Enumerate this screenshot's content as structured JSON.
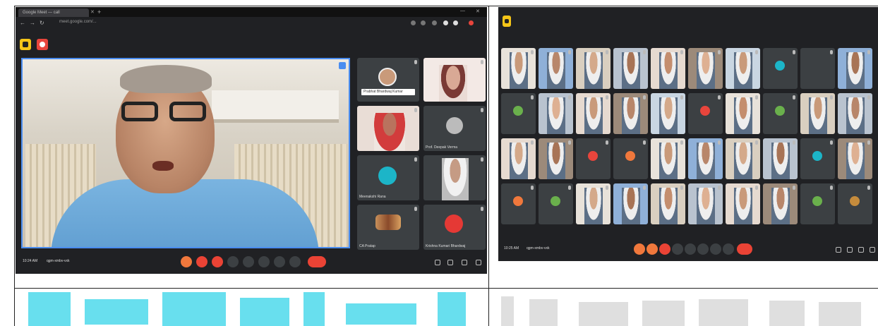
{
  "left_screen": {
    "browser_tab_title": "Google Meet — call",
    "url": "meet.google.com/...",
    "speaker_name": "",
    "tiles": [
      {
        "name": "",
        "chip": "Prabhat Bhardwaj Kumar"
      },
      {
        "name": ""
      },
      {
        "name": ""
      },
      {
        "name": "Prof. Deepak Verma"
      },
      {
        "name": "Meenakshi Rana"
      },
      {
        "name": ""
      },
      {
        "name": "CA Pratap"
      },
      {
        "name": "Krishna Kumari Bhardwaj"
      }
    ],
    "meeting_time": "10:24 AM",
    "meeting_code": "qgm-xmbv-vxk"
  },
  "right_screen": {
    "meeting_time": "10:25 AM",
    "meeting_code": "qgm-xmbv-vxk",
    "grid_rows": 4,
    "grid_cols": 10
  },
  "colors": {
    "meet_dark": "#202124",
    "tile": "#3c4043",
    "accent_blue": "#4a8df0",
    "end_call_red": "#ea4335",
    "brand_cyan": "#35d4e8"
  },
  "icons": [
    "meet-app-icon",
    "record-icon",
    "mic-icon",
    "camera-icon",
    "caption-icon",
    "present-icon",
    "raise-hand-icon",
    "more-icon",
    "end-call-icon",
    "info-icon",
    "people-icon",
    "chat-icon",
    "activities-icon"
  ]
}
